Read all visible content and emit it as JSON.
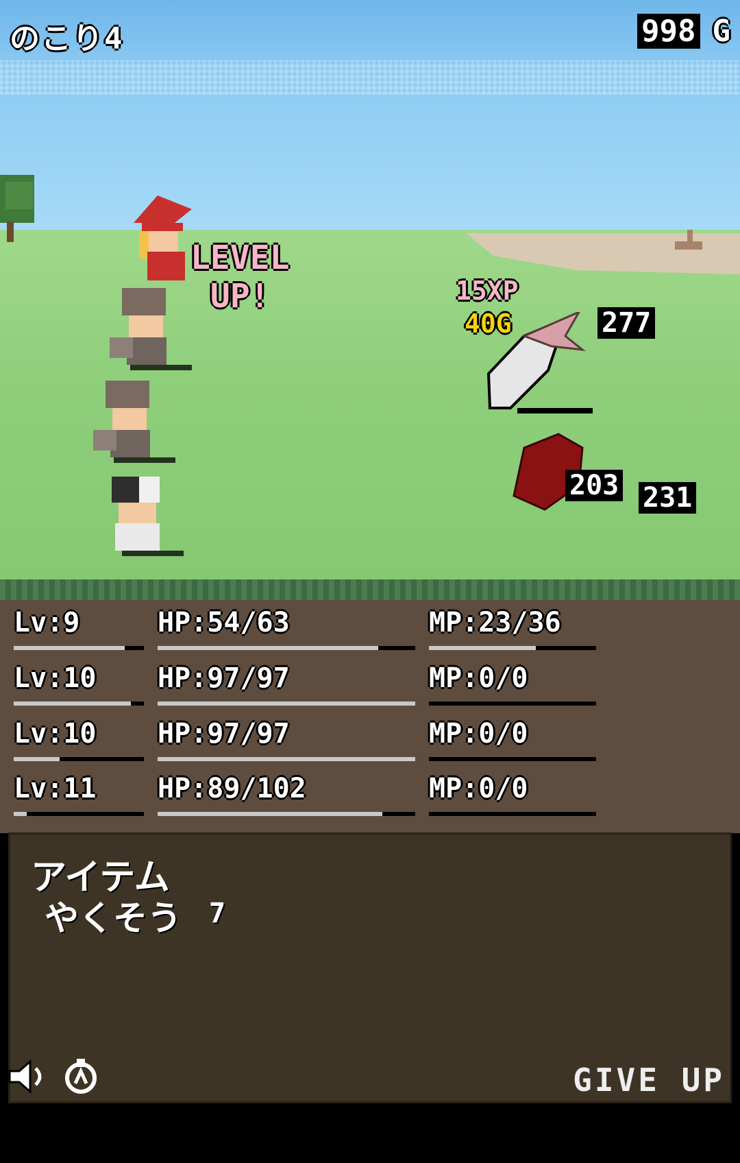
{
  "hud": {
    "remaining_label": "のこり4",
    "gold_value": "998",
    "gold_unit": "G"
  },
  "battle": {
    "level_up_line1": "LEVEL",
    "level_up_line2": "UP!",
    "xp_text": "15XP",
    "gold_gain_text": "40G",
    "enemy_hp_1": "277",
    "damage_text": "203",
    "enemy_hp_2": "231"
  },
  "party": [
    {
      "lv": "Lv:9",
      "hp": "HP:54/63",
      "mp": "MP:23/36",
      "lv_bar": 0.85,
      "hp_bar": 0.857,
      "mp_bar": 0.639
    },
    {
      "lv": "Lv:10",
      "hp": "HP:97/97",
      "mp": "MP:0/0",
      "lv_bar": 0.9,
      "hp_bar": 1.0,
      "mp_bar": 0.0
    },
    {
      "lv": "Lv:10",
      "hp": "HP:97/97",
      "mp": "MP:0/0",
      "lv_bar": 0.35,
      "hp_bar": 1.0,
      "mp_bar": 0.0
    },
    {
      "lv": "Lv:11",
      "hp": "HP:89/102",
      "mp": "MP:0/0",
      "lv_bar": 0.1,
      "hp_bar": 0.873,
      "mp_bar": 0.0
    }
  ],
  "panel": {
    "title": "アイテム",
    "item_name": "やくそう",
    "item_count": "7"
  },
  "footer": {
    "sound_icon": "speaker-icon",
    "auto_icon": "auto-icon",
    "give_up_label": "GIVE UP"
  },
  "colors": {
    "sky": "#8ccaf2",
    "grass": "#8fcf7c",
    "ground": "#5e4d3f",
    "panel": "#3e3426",
    "level_up": "#f7b6c6",
    "gold": "#f5d20f",
    "enemy": "#8b1212"
  }
}
